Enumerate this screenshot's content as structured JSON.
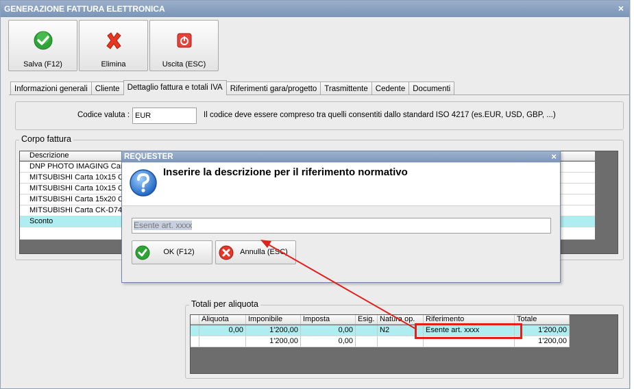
{
  "window": {
    "title": "GENERAZIONE FATTURA ELETTRONICA",
    "close_glyph": "×"
  },
  "toolbar": {
    "save_label": "Salva (F12)",
    "delete_label": "Elimina",
    "exit_label": "Uscita (ESC)"
  },
  "tabs": [
    {
      "label": "Informazioni generali"
    },
    {
      "label": "Cliente"
    },
    {
      "label": "Dettaglio fattura e totali IVA"
    },
    {
      "label": "Riferimenti gara/progetto"
    },
    {
      "label": "Trasmittente"
    },
    {
      "label": "Cedente"
    },
    {
      "label": "Documenti"
    }
  ],
  "currency": {
    "label": "Codice valuta :",
    "value": "EUR",
    "note": "Il codice deve essere compreso tra quelli consentiti dallo standard ISO 4217 (es.EUR, USD, GBP, ...)"
  },
  "corpo": {
    "title": "Corpo fattura",
    "header": "Descrizione",
    "rows": [
      "DNP PHOTO IMAGING Carta",
      "MITSUBISHI Carta 10x15 CK",
      "MITSUBISHI Carta 10x15 CK",
      "MITSUBISHI Carta 15x20 CK",
      "MITSUBISHI Carta CK-D746",
      "Sconto"
    ]
  },
  "totali": {
    "title": "Totali per aliquota",
    "columns": [
      "Aliquota",
      "Imponibile",
      "Imposta",
      "Esig.",
      "Natura op.",
      "Riferimento",
      "Totale"
    ],
    "rows": [
      [
        "0,00",
        "1'200,00",
        "0,00",
        "",
        "N2",
        "Esente art. xxxx",
        "1'200,00"
      ],
      [
        "",
        "1'200,00",
        "0,00",
        "",
        "",
        "",
        "1'200,00"
      ]
    ]
  },
  "dialog": {
    "title": "REQUESTER",
    "close_glyph": "×",
    "question": "Inserire la descrizione per il riferimento normativo",
    "input_value": "Esente art. xxxx",
    "ok_label": "OK (F12)",
    "cancel_label": "Annulla (ESC)"
  },
  "colors": {
    "selection": "#aeeef0",
    "annotation_red": "#e0201b",
    "title_bar": "#7b95b8"
  },
  "icons": [
    "check-icon",
    "delete-x-icon",
    "exit-icon",
    "question-icon",
    "cancel-icon"
  ]
}
